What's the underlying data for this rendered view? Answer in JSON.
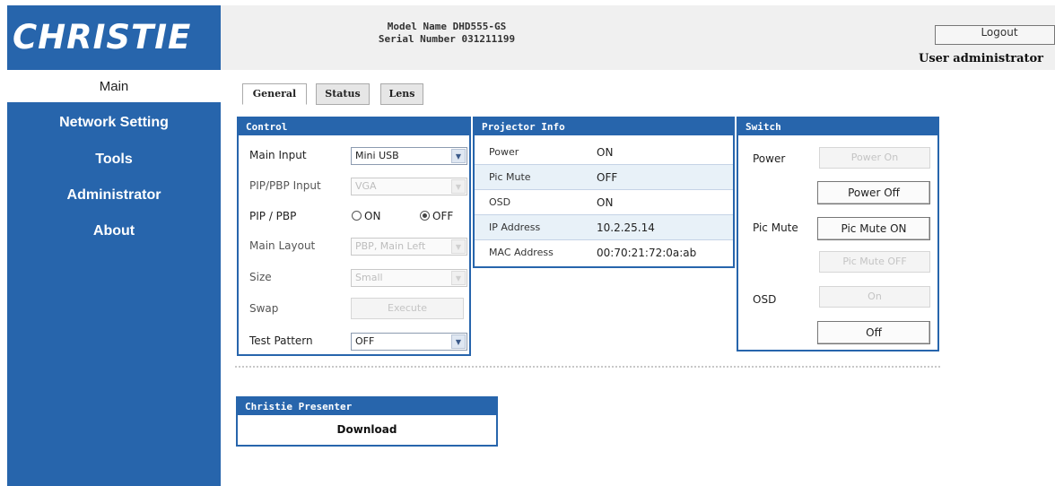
{
  "header": {
    "logo_text": "CHRISTIE",
    "model_name": "Model Name DHD555-GS",
    "serial_number": "Serial Number 031211199",
    "logout_label": "Logout",
    "user_label": "User administrator"
  },
  "sidebar": {
    "main_label": "Main",
    "items": [
      {
        "label": "Network Setting"
      },
      {
        "label": "Tools"
      },
      {
        "label": "Administrator"
      },
      {
        "label": "About"
      }
    ]
  },
  "tabs": [
    {
      "label": "General",
      "active": true
    },
    {
      "label": "Status",
      "active": false
    },
    {
      "label": "Lens",
      "active": false
    }
  ],
  "control": {
    "title": "Control",
    "main_input_label": "Main Input",
    "main_input_value": "Mini USB",
    "pip_input_label": "PIP/PBP Input",
    "pip_input_value": "VGA",
    "pip_label": "PIP / PBP",
    "pip_on_label": "ON",
    "pip_off_label": "OFF",
    "pip_selected": "OFF",
    "layout_label": "Main Layout",
    "layout_value": "PBP, Main Left",
    "size_label": "Size",
    "size_value": "Small",
    "swap_label": "Swap",
    "swap_button": "Execute",
    "test_pattern_label": "Test Pattern",
    "test_pattern_value": "OFF"
  },
  "projector_info": {
    "title": "Projector Info",
    "rows": [
      {
        "key": "Power",
        "value": "ON"
      },
      {
        "key": "Pic Mute",
        "value": "OFF"
      },
      {
        "key": "OSD",
        "value": "ON"
      },
      {
        "key": "IP Address",
        "value": "10.2.25.14"
      },
      {
        "key": "MAC Address",
        "value": "00:70:21:72:0a:ab"
      }
    ]
  },
  "switch": {
    "title": "Switch",
    "power_label": "Power",
    "power_on_button": "Power On",
    "power_off_button": "Power Off",
    "pic_mute_label": "Pic Mute",
    "pic_mute_on_button": "Pic Mute ON",
    "pic_mute_off_button": "Pic Mute OFF",
    "osd_label": "OSD",
    "osd_on_button": "On",
    "osd_off_button": "Off"
  },
  "presenter": {
    "title": "Christie Presenter",
    "download_label": "Download"
  },
  "colors": {
    "brand_blue": "#2765ac",
    "header_bg": "#f0f0f0",
    "row_alt": "#e8f1f8"
  }
}
